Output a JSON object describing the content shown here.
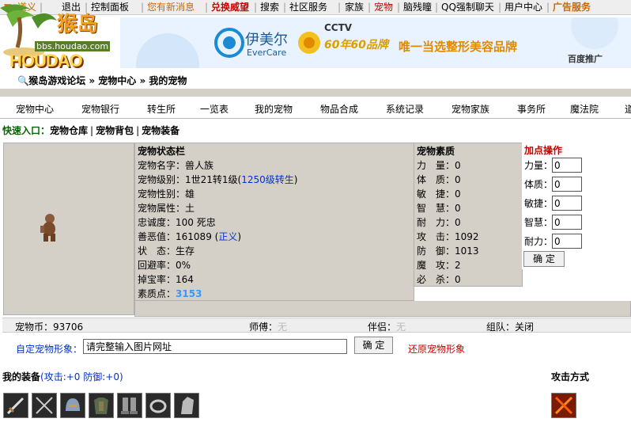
{
  "topbar": {
    "items": [
      {
        "label": "道义",
        "color": "#cc6600"
      },
      {
        "label": "退出",
        "color": "#000000"
      },
      {
        "label": "控制面板",
        "color": "#000000"
      },
      {
        "label": "您有新消息",
        "color": "#cc6600"
      },
      {
        "label": "兑换威望",
        "color": "#cc0000"
      },
      {
        "label": "搜索",
        "color": "#000000"
      },
      {
        "label": "社区服务",
        "color": "#000000"
      },
      {
        "label": "家族",
        "color": "#000000"
      },
      {
        "label": "宠物",
        "color": "#cc0000"
      },
      {
        "label": "脑残瞳",
        "color": "#000000"
      },
      {
        "label": "QQ强制聊天",
        "color": "#000000"
      },
      {
        "label": "用户中心",
        "color": "#000000"
      },
      {
        "label": "广告服务",
        "color": "#cc6600"
      }
    ],
    "sub_arrow": "▼"
  },
  "logo": {
    "text": "猴岛",
    "site": "bbs.houdao.com",
    "brand": "HOUDAO"
  },
  "banner": {
    "brand1": "伊美尔",
    "brand1_en": "EverCare",
    "cctv": "CCTV",
    "years": "60年60品牌",
    "slogan": "唯一当选整形美容品牌",
    "baidu": "百度推广"
  },
  "breadcrumb": {
    "icon": "search-icon",
    "text": "猴岛游戏论坛 » 宠物中心 » 我的宠物"
  },
  "nav": {
    "items": [
      "宠物中心",
      "宠物银行",
      "转生所",
      "一览表",
      "我的宠物",
      "物品合成",
      "系统记录",
      "宠物家族",
      "事务所",
      "魔法院",
      "道"
    ]
  },
  "quick": {
    "label": "快速入口：",
    "links": [
      "宠物仓库",
      "宠物背包",
      "宠物装备"
    ]
  },
  "status": {
    "title": "宠物状态栏",
    "name_label": "宠物名字：",
    "name": "兽人族",
    "level_label": "宠物级别：",
    "level": "1世21转1级(",
    "level_link": "1250级转生",
    "level_end": ")",
    "gender_label": "宠物性别：",
    "gender": "雄",
    "attr_label": "宠物属性：",
    "attr": "土",
    "loyalty_label": "忠诚度：",
    "loyalty": "100 死忠",
    "karma_label": "善恶值：",
    "karma": "161089 (",
    "karma_link": "正义",
    "karma_end": ")",
    "state_label": "状　态：",
    "state": "生存",
    "dodge_label": "回避率：",
    "dodge": "0%",
    "drop_label": "掉宝率：",
    "drop": "164",
    "points_label": "素质点：",
    "points": "3153"
  },
  "attrs": {
    "title": "宠物素质",
    "rows": [
      {
        "label": "力　量：",
        "value": "0"
      },
      {
        "label": "体　质：",
        "value": "0"
      },
      {
        "label": "敏　捷：",
        "value": "0"
      },
      {
        "label": "智　慧：",
        "value": "0"
      },
      {
        "label": "耐　力：",
        "value": "0"
      },
      {
        "label": "攻　击：",
        "value": "1092"
      },
      {
        "label": "防　御：",
        "value": "1013"
      },
      {
        "label": "魔　攻：",
        "value": "2"
      },
      {
        "label": "必　杀：",
        "value": "0"
      }
    ]
  },
  "addpts": {
    "title": "加点操作",
    "rows": [
      {
        "label": "力量：",
        "value": "0"
      },
      {
        "label": "体质：",
        "value": "0"
      },
      {
        "label": "敏捷：",
        "value": "0"
      },
      {
        "label": "智慧：",
        "value": "0"
      },
      {
        "label": "耐力：",
        "value": "0"
      }
    ],
    "confirm": "确 定"
  },
  "info": {
    "coin_label": "宠物币：",
    "coin": "93706",
    "master_label": "师傅：",
    "master": "无",
    "partner_label": "伴侣：",
    "partner": "无",
    "team_label": "组队：",
    "team": "关闭"
  },
  "custom": {
    "label": "自定宠物形象：",
    "input_value": "请完整输入图片网址",
    "confirm": "确 定",
    "restore": "还原宠物形象"
  },
  "equip": {
    "title": "我的装备",
    "stats": "(攻击:+0 防御:+0)",
    "attack_title": "攻击方式",
    "items": [
      "sword-icon",
      "crossed-swords-icon",
      "helmet-icon",
      "armor-icon",
      "boots-icon",
      "ring-icon",
      "gauntlet-icon"
    ]
  }
}
